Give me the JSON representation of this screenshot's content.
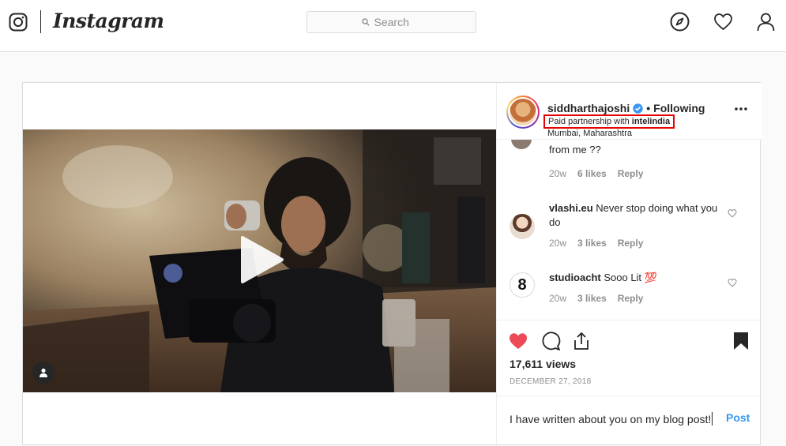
{
  "nav": {
    "wordmark": "Instagram",
    "search_placeholder": "Search",
    "icons": [
      "instagram-glyph-icon",
      "compass-icon",
      "heart-icon",
      "profile-icon"
    ]
  },
  "post": {
    "author": "siddharthajoshi",
    "follow_separator": "•",
    "follow_state": "Following",
    "partnership_prefix": "Paid partnership with ",
    "partner": "intelindia",
    "location": "Mumbai, Maharashtra",
    "views": "17,611 views",
    "date": "DECEMBER 27, 2018",
    "liked": true
  },
  "comments": [
    {
      "user": "",
      "text": "from me ??",
      "age": "20w",
      "likes": "6 likes",
      "reply": "Reply"
    },
    {
      "user": "vlashi.eu",
      "text": " Never stop doing what you do",
      "age": "20w",
      "likes": "3 likes",
      "reply": "Reply"
    },
    {
      "user": "studioacht",
      "text": " Sooo Lit 💯",
      "age": "20w",
      "likes": "3 likes",
      "reply": "Reply",
      "avatar_glyph": "8"
    }
  ],
  "composer": {
    "value": "I have written about you on my blog post!",
    "post_label": "Post"
  },
  "colors": {
    "accent": "#3897f0",
    "like": "#ed4956",
    "highlight_box": "#e60000"
  }
}
